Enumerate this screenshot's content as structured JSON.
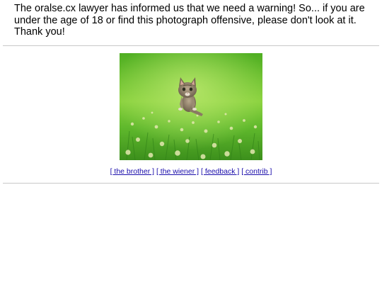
{
  "warning": {
    "text": "The oralse.cx lawyer has informed us that we need a warning! So... if you are under the age of 18 or find this photograph offensive, please don't look at it. Thank you!"
  },
  "photo": {
    "subject": "kitten-leaping-through-grass",
    "colors": {
      "grass_light": "#9ad94a",
      "grass_dark": "#3f9a1e",
      "flower": "#e6e6b0"
    }
  },
  "links": [
    {
      "label": "[ the brother ]"
    },
    {
      "label": "[ the wiener ]"
    },
    {
      "label": "[ feedback ]"
    },
    {
      "label": "[ contrib ]"
    }
  ],
  "colors": {
    "link": "#1a0dab",
    "rule": "#c8c8c8"
  }
}
